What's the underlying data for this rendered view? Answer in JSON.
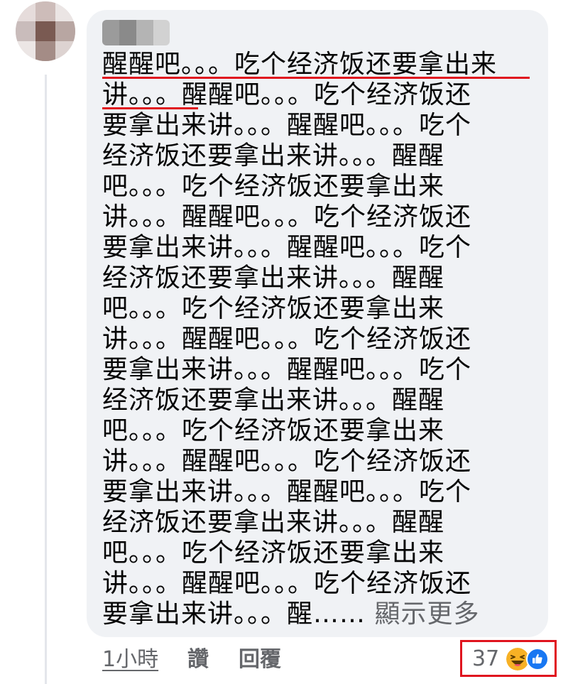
{
  "comment": {
    "lines": [
      "醒醒吧。。。吃个经济饭还要拿出来",
      "讲。。。醒醒吧。。。吃个经济饭还",
      "要拿出来讲。。。醒醒吧。。。吃个",
      "经济饭还要拿出来讲。。。醒醒",
      "吧。。。吃个经济饭还要拿出来",
      "讲。。。醒醒吧。。。吃个经济饭还",
      "要拿出来讲。。。醒醒吧。。。吃个",
      "经济饭还要拿出来讲。。。醒醒",
      "吧。。。吃个经济饭还要拿出来",
      "讲。。。醒醒吧。。。吃个经济饭还",
      "要拿出来讲。。。醒醒吧。。。吃个",
      "经济饭还要拿出来讲。。。醒醒",
      "吧。。。吃个经济饭还要拿出来",
      "讲。。。醒醒吧。。。吃个经济饭还",
      "要拿出来讲。。。醒醒吧。。。吃个",
      "经济饭还要拿出来讲。。。醒醒",
      "吧。。。吃个经济饭还要拿出来",
      "讲。。。醒醒吧。。。吃个经济饭还"
    ],
    "last_line_text": "要拿出来讲。。。醒……",
    "see_more_label": "顯示更多"
  },
  "actions": {
    "time": "1小時",
    "like_label": "讚",
    "reply_label": "回覆"
  },
  "reactions": {
    "count": "37",
    "icons": [
      "haha-icon",
      "like-icon"
    ]
  },
  "colors": {
    "bubble": "#f0f2f5",
    "annotation_red": "#e0141e",
    "secondary_text": "#65676b",
    "like_blue": "#1877f2",
    "haha_yellow": "#f7b125"
  }
}
